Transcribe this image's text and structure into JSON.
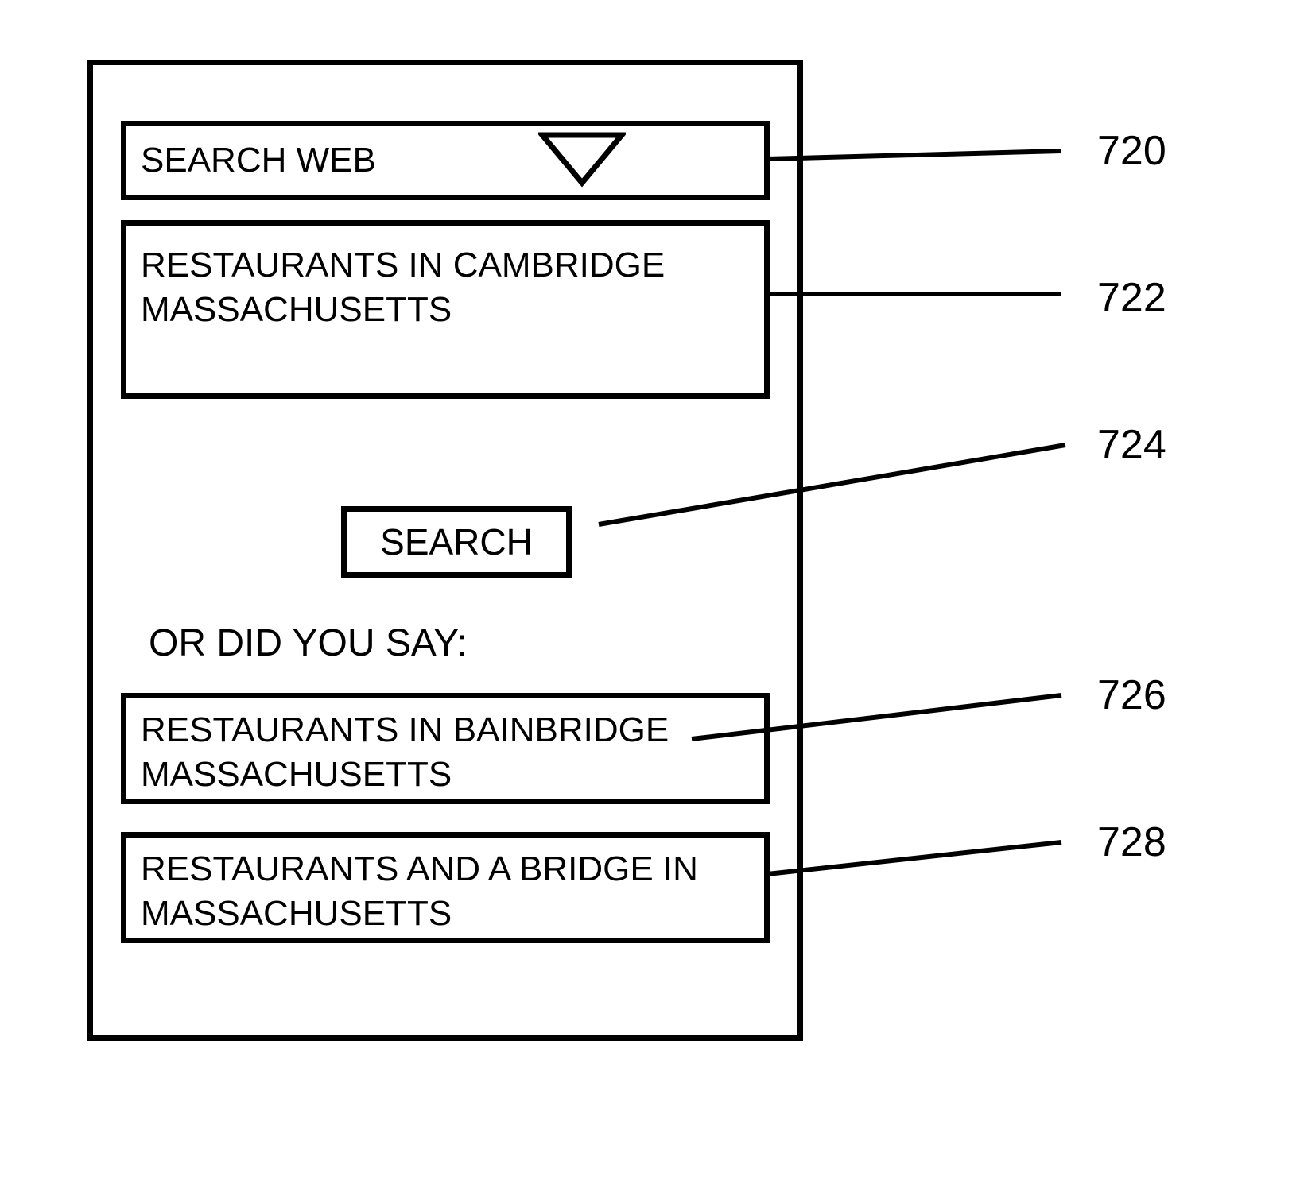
{
  "dropdown": {
    "label": "SEARCH WEB"
  },
  "input": {
    "value": "RESTAURANTS IN CAMBRIDGE MASSACHUSETTS"
  },
  "search_button": {
    "label": "SEARCH"
  },
  "prompt": "OR DID YOU SAY:",
  "alternates": [
    {
      "text": "RESTAURANTS IN BAINBRIDGE MASSACHUSETTS"
    },
    {
      "text": "RESTAURANTS AND A BRIDGE IN MASSACHUSETTS"
    }
  ],
  "refs": {
    "dropdown": "720",
    "input": "722",
    "button": "724",
    "alt1": "726",
    "alt2": "728"
  }
}
